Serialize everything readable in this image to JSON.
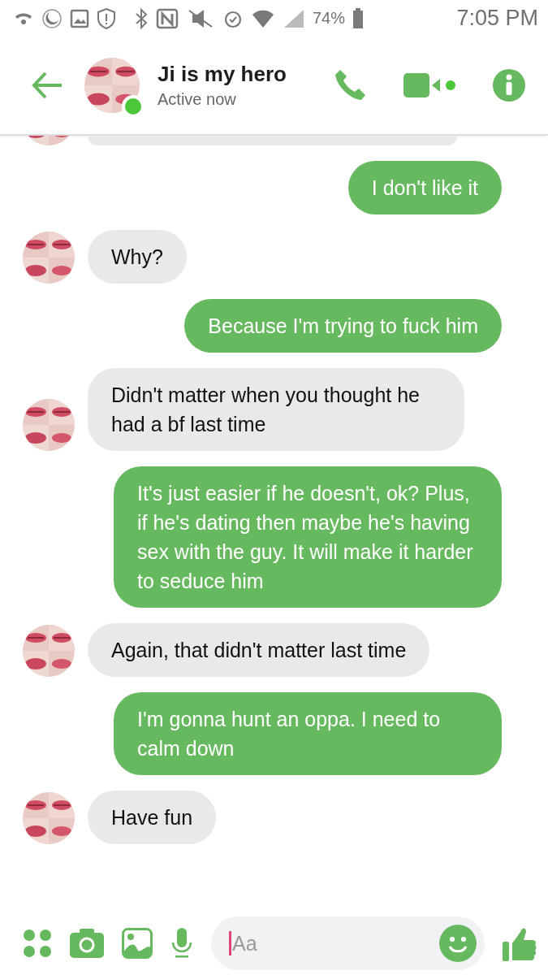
{
  "status_bar": {
    "battery": "74%",
    "time": "7:05 PM"
  },
  "header": {
    "title": "Ji is my hero",
    "subtitle": "Active now",
    "online": true
  },
  "messages": [
    {
      "kind": "cut"
    },
    {
      "kind": "sent",
      "text": "I don't like it"
    },
    {
      "kind": "received",
      "text": "Why?"
    },
    {
      "kind": "sent",
      "text": "Because I'm trying to fuck him"
    },
    {
      "kind": "received",
      "text": "Didn't matter when you thought he had a bf last time"
    },
    {
      "kind": "sent",
      "text": "It's just easier if he doesn't, ok? Plus, if he's dating then maybe he's having sex with the guy. It will make it harder to seduce him"
    },
    {
      "kind": "received",
      "text": "Again, that didn't matter last time"
    },
    {
      "kind": "sent",
      "text": "I'm gonna hunt an oppa. I need to calm down"
    },
    {
      "kind": "received",
      "text": "Have fun"
    }
  ],
  "composer": {
    "placeholder": "Aa"
  }
}
